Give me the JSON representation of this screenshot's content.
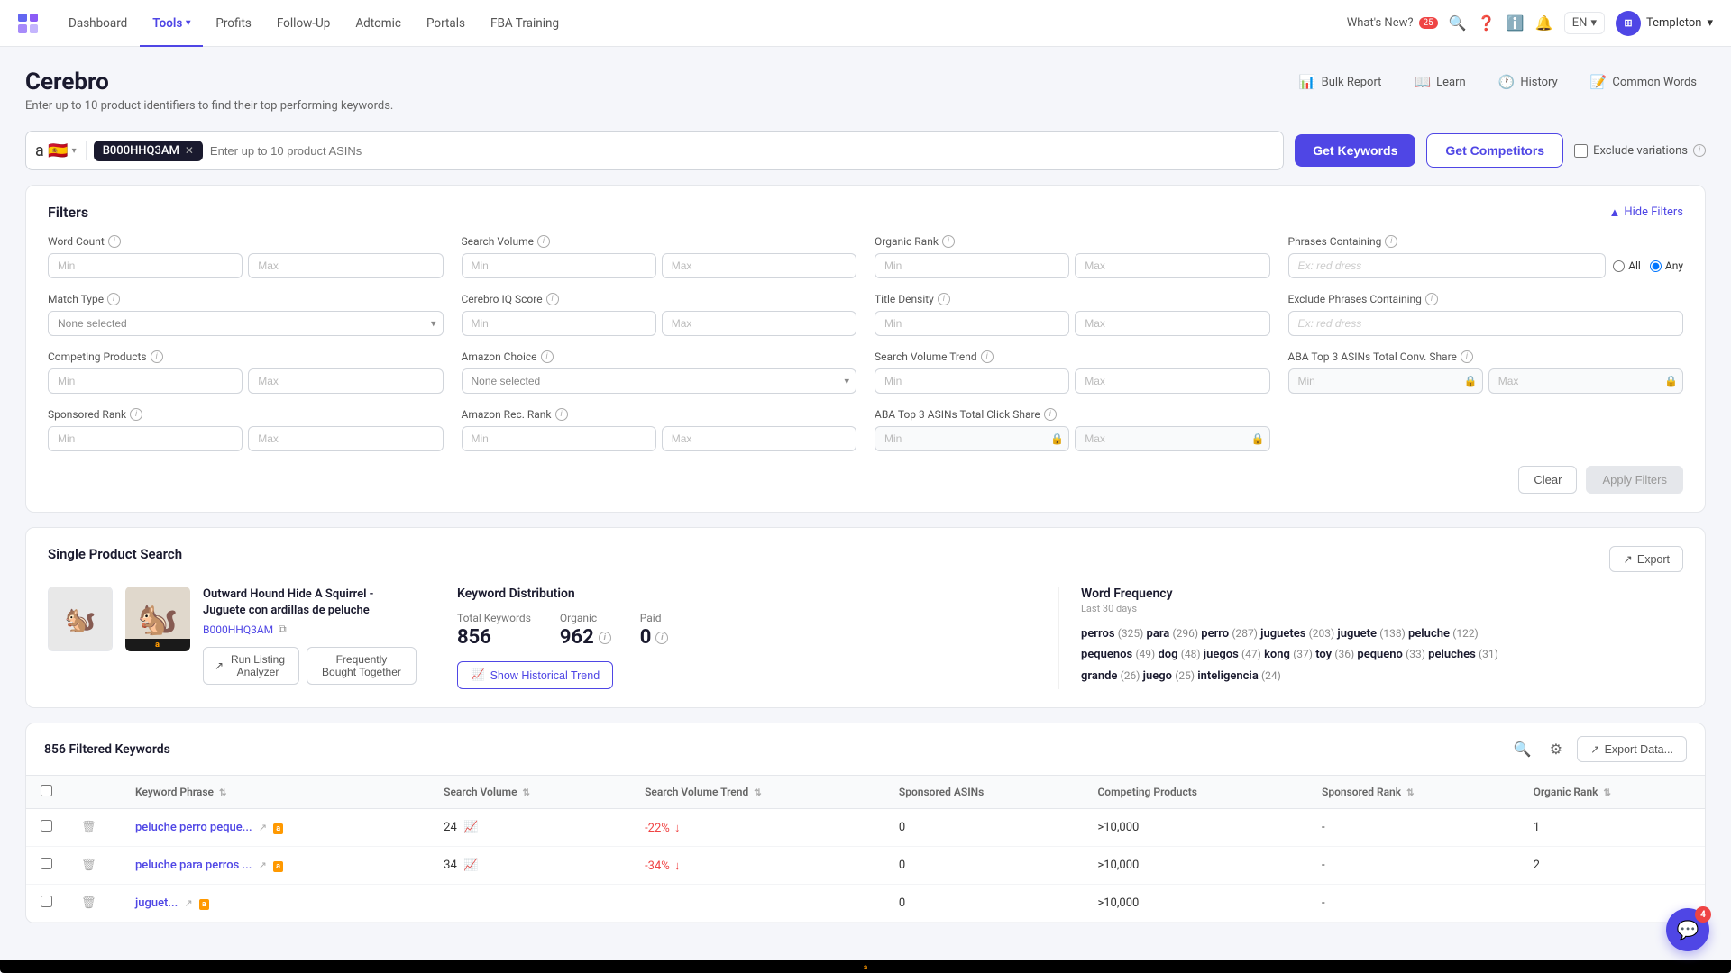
{
  "nav": {
    "items": [
      "Dashboard",
      "Tools",
      "Profits",
      "Follow-Up",
      "Adtomic",
      "Portals",
      "FBA Training"
    ],
    "active": "Tools",
    "whats_new": "What's New?",
    "badge": "25",
    "lang": "EN",
    "user": "Templeton"
  },
  "page": {
    "title": "Cerebro",
    "subtitle": "Enter up to 10 product identifiers to find their top performing keywords.",
    "actions": {
      "bulk_report": "Bulk Report",
      "learn": "Learn",
      "history": "History",
      "common_words": "Common Words"
    }
  },
  "search": {
    "asin": "B000HHQ3AM",
    "placeholder": "Enter up to 10 product ASINs",
    "get_keywords": "Get Keywords",
    "get_competitors": "Get Competitors",
    "exclude_variations": "Exclude variations",
    "marketplace": "🇪🇸"
  },
  "filters": {
    "title": "Filters",
    "hide_label": "Hide Filters",
    "groups": [
      {
        "label": "Word Count",
        "min": "",
        "max": ""
      },
      {
        "label": "Search Volume",
        "min": "",
        "max": ""
      },
      {
        "label": "Organic Rank",
        "min": "",
        "max": ""
      },
      {
        "label": "Match Type",
        "type": "select",
        "value": "None selected"
      },
      {
        "label": "Phrases Containing",
        "type": "text",
        "placeholder": "Ex: red dress"
      },
      {
        "label": "Cerebro IQ Score",
        "min": "",
        "max": ""
      },
      {
        "label": "Title Density",
        "min": "",
        "max": ""
      },
      {
        "label": "Competing Products",
        "min": "",
        "max": ""
      },
      {
        "label": "Amazon Choice",
        "type": "select",
        "value": "None selected"
      },
      {
        "label": "Exclude Phrases Containing",
        "type": "text",
        "placeholder": "Ex: red dress"
      },
      {
        "label": "Search Volume Trend",
        "min": "",
        "max": ""
      },
      {
        "label": "Sponsored Rank",
        "min": "",
        "max": ""
      },
      {
        "label": "Amazon Rec. Rank",
        "min": "",
        "max": ""
      },
      {
        "label": "ABA Top 3 ASINs Total Click Share",
        "min": "",
        "max": "",
        "locked": true
      },
      {
        "label": "ABA Top 3 ASINs Total Conv. Share",
        "min": "",
        "max": "",
        "locked": true
      }
    ],
    "clear": "Clear",
    "apply": "Apply Filters"
  },
  "product": {
    "section_title": "Single Product Search",
    "name": "Outward Hound Hide A Squirrel - Juguete con ardillas de peluche",
    "asin": "B000HHQ3AM",
    "run_listing": "Run Listing Analyzer",
    "frequently_bought": "Frequently Bought Together",
    "export": "Export"
  },
  "keyword_distribution": {
    "title": "Keyword Distribution",
    "total_label": "Total Keywords",
    "total_value": "856",
    "organic_label": "Organic",
    "organic_value": "962",
    "paid_label": "Paid",
    "paid_value": "0",
    "show_historical": "Show Historical Trend"
  },
  "word_frequency": {
    "title": "Word Frequency",
    "subtitle": "Last 30 days",
    "words": [
      {
        "word": "perros",
        "count": 325
      },
      {
        "word": "para",
        "count": 296
      },
      {
        "word": "perro",
        "count": 287
      },
      {
        "word": "juguetes",
        "count": 203
      },
      {
        "word": "juguete",
        "count": 138
      },
      {
        "word": "peluche",
        "count": 122
      },
      {
        "word": "pequenos",
        "count": 49
      },
      {
        "word": "dog",
        "count": 48
      },
      {
        "word": "juegos",
        "count": 47
      },
      {
        "word": "kong",
        "count": 37
      },
      {
        "word": "toy",
        "count": 36
      },
      {
        "word": "pequeno",
        "count": 33
      },
      {
        "word": "peluches",
        "count": 31
      },
      {
        "word": "grande",
        "count": 26
      },
      {
        "word": "juego",
        "count": 25
      },
      {
        "word": "inteligencia",
        "count": 24
      }
    ]
  },
  "table": {
    "filtered_count": "856 Filtered Keywords",
    "export_label": "Export Data...",
    "columns": [
      "Keyword Phrase",
      "Search Volume",
      "Search Volume Trend",
      "Sponsored ASINs",
      "Competing Products",
      "Sponsored Rank",
      "Organic Rank"
    ],
    "rows": [
      {
        "keyword": "peluche perro peque...",
        "search_volume": "24",
        "sv_trend": "-22%",
        "trend_dir": "down",
        "sponsored_asins": "0",
        "competing_products": ">10,000",
        "sponsored_rank": "-",
        "organic_rank": "1"
      },
      {
        "keyword": "peluche para perros ...",
        "search_volume": "34",
        "sv_trend": "-34%",
        "trend_dir": "down",
        "sponsored_asins": "0",
        "competing_products": ">10,000",
        "sponsored_rank": "-",
        "organic_rank": "2"
      },
      {
        "keyword": "juguet...",
        "search_volume": "",
        "sv_trend": "",
        "trend_dir": "down",
        "sponsored_asins": "0",
        "competing_products": ">10,000",
        "sponsored_rank": "-",
        "organic_rank": ""
      }
    ]
  },
  "chat": {
    "badge": "4"
  }
}
